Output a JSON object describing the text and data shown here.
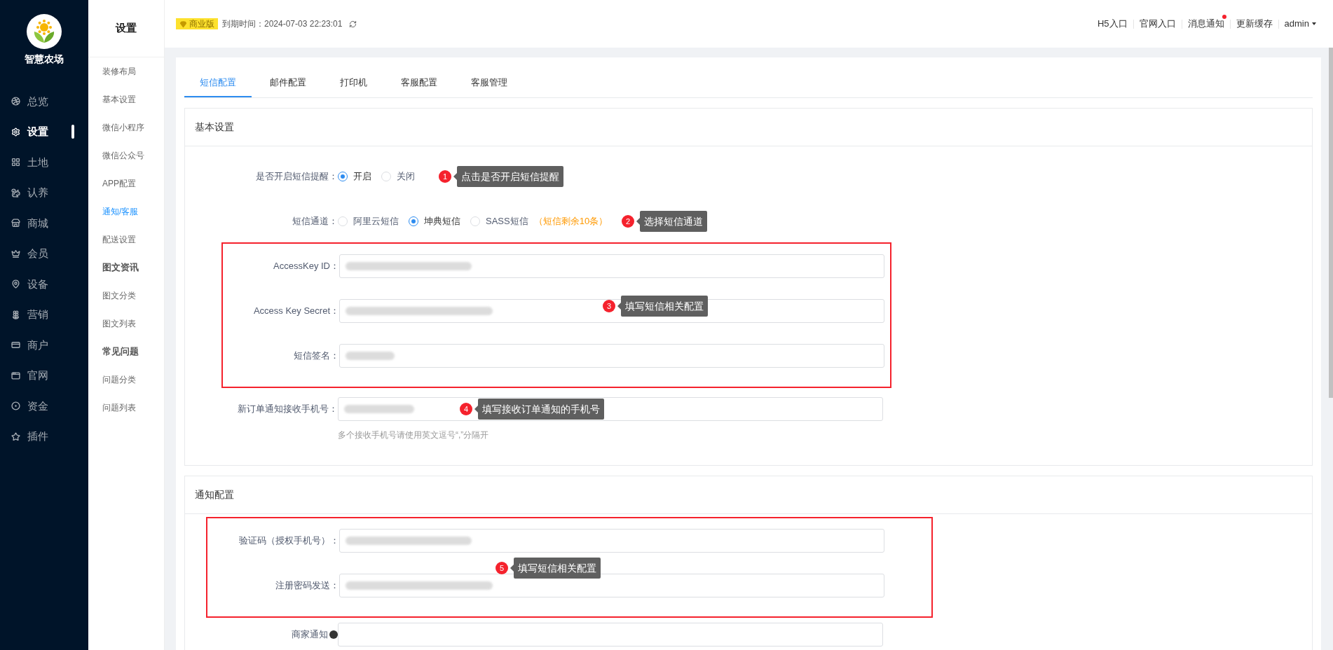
{
  "sidebar": {
    "logo_text": "智慧农场",
    "items": [
      {
        "label": "总览",
        "selected": false
      },
      {
        "label": "设置",
        "selected": true
      },
      {
        "label": "土地",
        "selected": false
      },
      {
        "label": "认养",
        "selected": false
      },
      {
        "label": "商城",
        "selected": false
      },
      {
        "label": "会员",
        "selected": false
      },
      {
        "label": "设备",
        "selected": false
      },
      {
        "label": "营销",
        "selected": false
      },
      {
        "label": "商户",
        "selected": false
      },
      {
        "label": "官网",
        "selected": false
      },
      {
        "label": "资金",
        "selected": false
      },
      {
        "label": "插件",
        "selected": false
      }
    ]
  },
  "submenu": {
    "title": "设置",
    "items": [
      {
        "kind": "link",
        "label": "装修布局",
        "selected": false
      },
      {
        "kind": "link",
        "label": "基本设置",
        "selected": false
      },
      {
        "kind": "link",
        "label": "微信小程序",
        "selected": false
      },
      {
        "kind": "link",
        "label": "微信公众号",
        "selected": false
      },
      {
        "kind": "link",
        "label": "APP配置",
        "selected": false
      },
      {
        "kind": "link",
        "label": "通知/客服",
        "selected": true
      },
      {
        "kind": "link",
        "label": "配送设置",
        "selected": false
      },
      {
        "kind": "group",
        "label": "图文资讯"
      },
      {
        "kind": "link",
        "label": "图文分类",
        "selected": false
      },
      {
        "kind": "link",
        "label": "图文列表",
        "selected": false
      },
      {
        "kind": "group",
        "label": "常见问题"
      },
      {
        "kind": "link",
        "label": "问题分类",
        "selected": false
      },
      {
        "kind": "link",
        "label": "问题列表",
        "selected": false
      }
    ]
  },
  "topbar": {
    "edition_badge": "商业版",
    "expiry": "到期时间：2024-07-03 22:23:01",
    "links": [
      {
        "label": "H5入口",
        "dot": false,
        "dropdown": false
      },
      {
        "label": "官网入口",
        "dot": false,
        "dropdown": false
      },
      {
        "label": "消息通知",
        "dot": true,
        "dropdown": false
      },
      {
        "label": "更新缓存",
        "dot": false,
        "dropdown": false
      },
      {
        "label": "admin",
        "dot": false,
        "dropdown": true
      }
    ]
  },
  "tabs": [
    {
      "label": "短信配置",
      "selected": true
    },
    {
      "label": "邮件配置",
      "selected": false
    },
    {
      "label": "打印机",
      "selected": false
    },
    {
      "label": "客服配置",
      "selected": false
    },
    {
      "label": "客服管理",
      "selected": false
    }
  ],
  "sections": [
    {
      "title": "基本设置",
      "rows": [
        {
          "kind": "radio",
          "label": "是否开启短信提醒：",
          "options": [
            {
              "label": "开启",
              "selected": true
            },
            {
              "label": "关闭",
              "selected": false
            }
          ],
          "callout": {
            "number": "1",
            "text": "点击是否开启短信提醒"
          }
        },
        {
          "kind": "radio",
          "label": "短信通道：",
          "options": [
            {
              "label": "阿里云短信",
              "selected": false
            },
            {
              "label": "坤典短信",
              "selected": true
            },
            {
              "label": "SASS短信",
              "selected": false
            }
          ],
          "note": "（短信剩余10条）",
          "callout": {
            "number": "2",
            "text": "选择短信通道"
          }
        },
        {
          "kind": "frame",
          "callout": {
            "number": "3",
            "text": "填写短信相关配置"
          },
          "rows": [
            {
              "kind": "input",
              "label": "AccessKey ID：",
              "redacted": true
            },
            {
              "kind": "input",
              "label": "Access Key Secret：",
              "redacted": true
            },
            {
              "kind": "input",
              "label": "短信签名：",
              "redacted": true
            }
          ]
        },
        {
          "kind": "input",
          "label": "新订单通知接收手机号：",
          "redacted": true,
          "hint": "多个接收手机号请使用英文逗号“,”分隔开",
          "callout": {
            "number": "4",
            "text": "填写接收订单通知的手机号"
          }
        }
      ]
    },
    {
      "title": "通知配置",
      "rows": [
        {
          "kind": "frame",
          "callout": {
            "number": "5",
            "text": "填写短信相关配置"
          },
          "rows": [
            {
              "kind": "input",
              "label": "验证码（授权手机号）：",
              "redacted": true
            },
            {
              "kind": "input",
              "label": "注册密码发送：",
              "redacted": true
            }
          ]
        },
        {
          "kind": "input",
          "label": "商家通知",
          "info": true,
          "redacted": false
        }
      ]
    }
  ]
}
